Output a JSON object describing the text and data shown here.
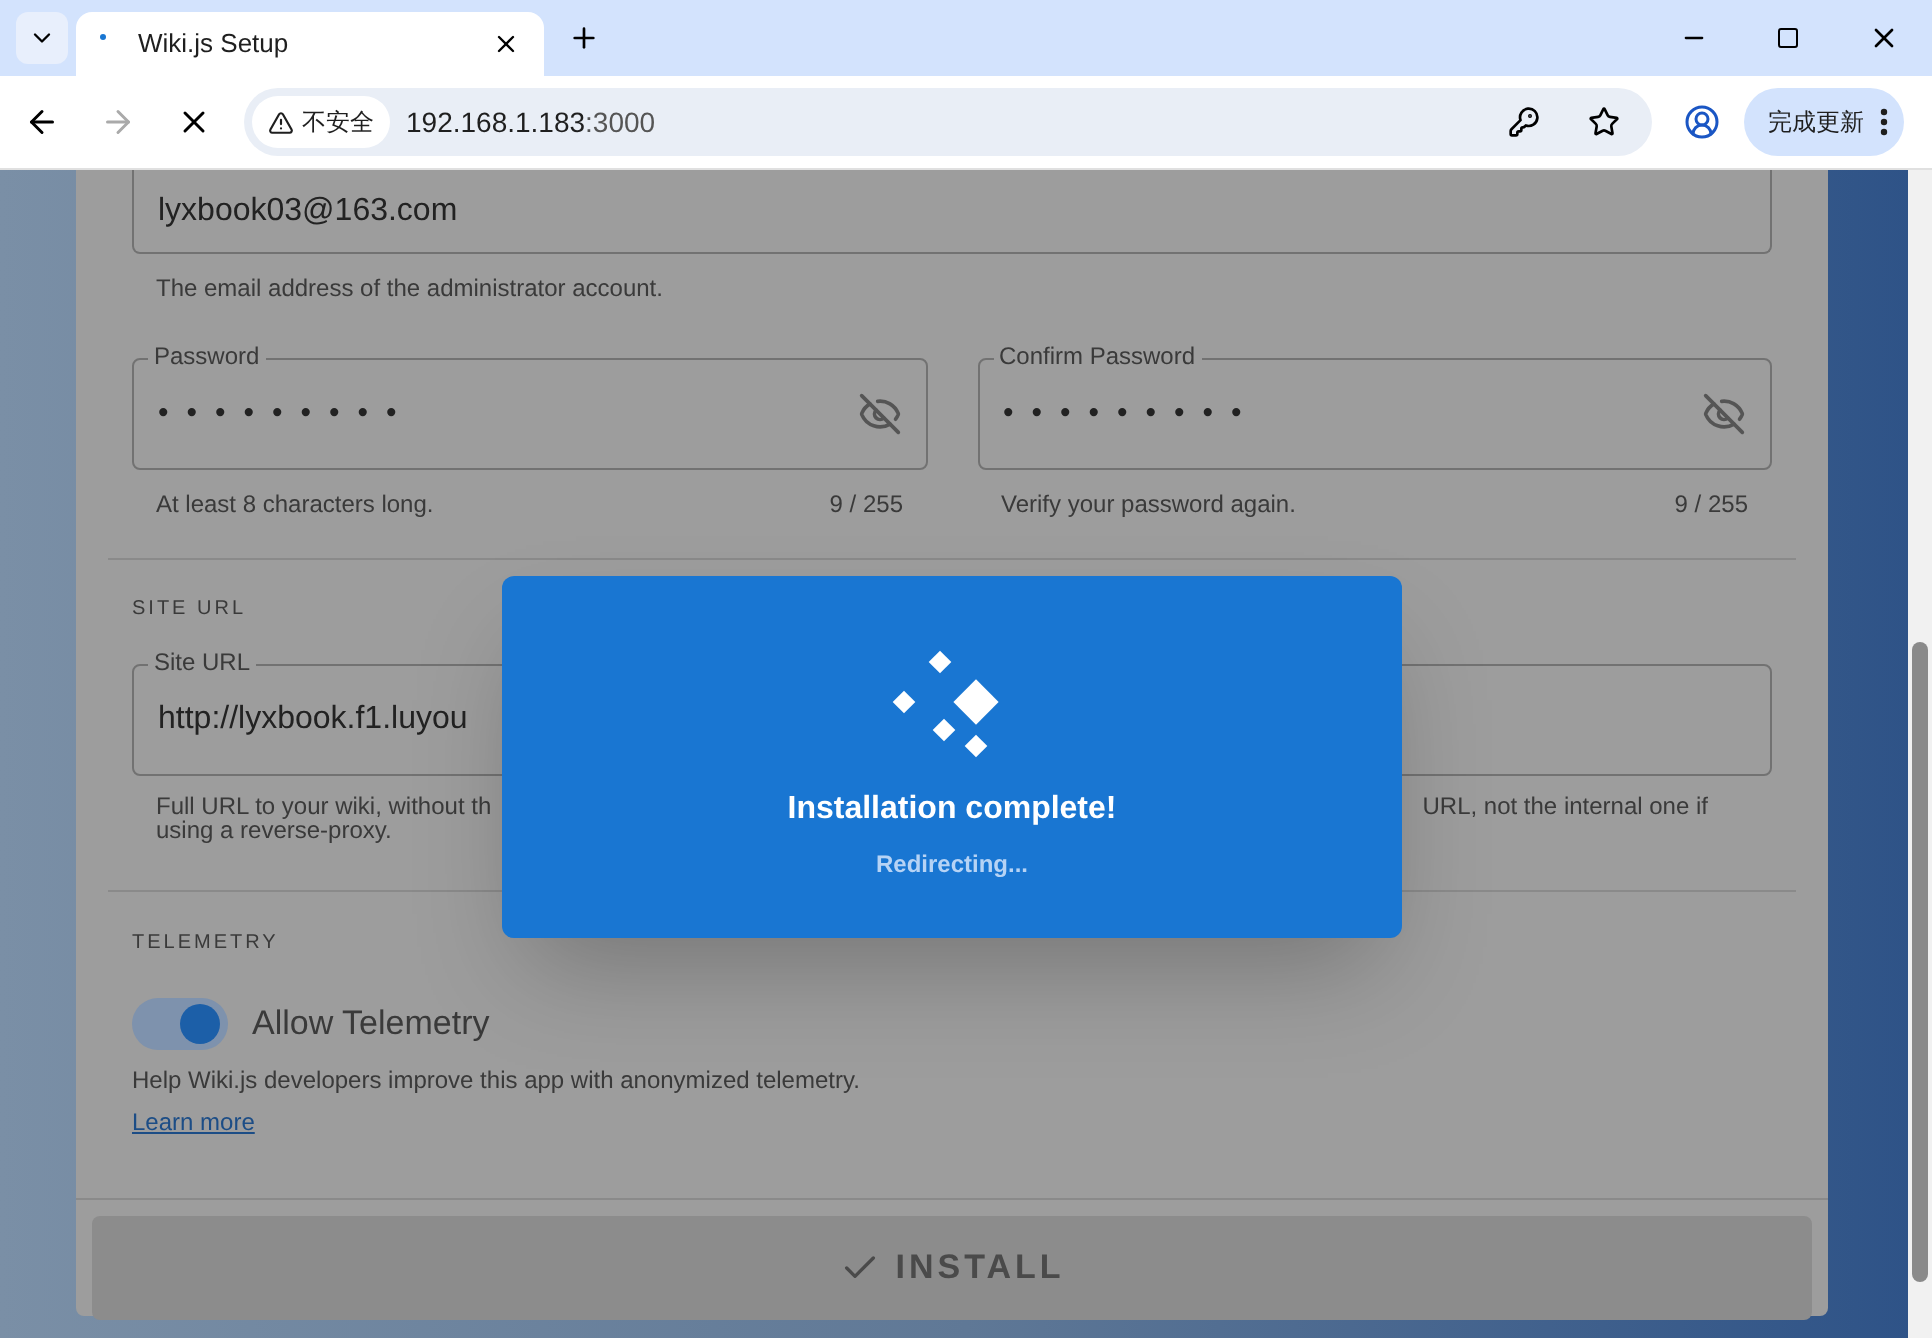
{
  "browser": {
    "tab_title": "Wiki.js Setup",
    "security_label": "不安全",
    "url_host": "192.168.1.183",
    "url_port": ":3000",
    "update_button": "完成更新"
  },
  "form": {
    "email": {
      "value": "lyxbook03@163.com",
      "hint": "The email address of the administrator account."
    },
    "passwords": [
      {
        "label": "Password",
        "value": "•••••••••",
        "hint": "At least 8 characters long.",
        "counter": "9 / 255"
      },
      {
        "label": "Confirm Password",
        "value": "•••••••••",
        "hint": "Verify your password again.",
        "counter": "9 / 255"
      }
    ],
    "site_url": {
      "heading": "SITE URL",
      "label": "Site URL",
      "value": "http://lyxbook.f1.luyou",
      "hint_left": "Full URL to your wiki, without th",
      "hint_right": "URL, not the internal one if",
      "hint_line2": "using a reverse-proxy."
    },
    "telemetry": {
      "heading": "TELEMETRY",
      "label": "Allow Telemetry",
      "on": true,
      "hint": "Help Wiki.js developers improve this app with anonymized telemetry.",
      "link": "Learn more"
    },
    "install_button": {
      "label": "INSTALL",
      "disabled": true
    }
  },
  "dialog": {
    "title": "Installation complete!",
    "subtitle": "Redirecting..."
  }
}
